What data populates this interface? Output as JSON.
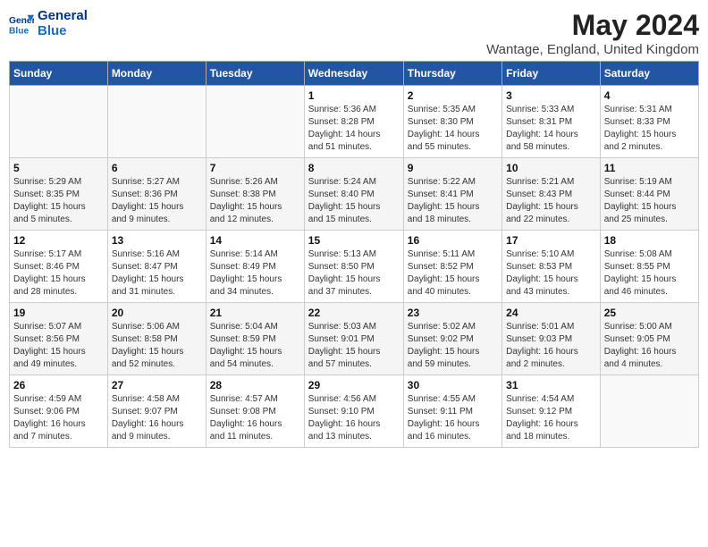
{
  "header": {
    "logo_line1": "General",
    "logo_line2": "Blue",
    "title": "May 2024",
    "subtitle": "Wantage, England, United Kingdom"
  },
  "columns": [
    "Sunday",
    "Monday",
    "Tuesday",
    "Wednesday",
    "Thursday",
    "Friday",
    "Saturday"
  ],
  "weeks": [
    {
      "days": [
        {
          "num": "",
          "info": ""
        },
        {
          "num": "",
          "info": ""
        },
        {
          "num": "",
          "info": ""
        },
        {
          "num": "1",
          "info": "Sunrise: 5:36 AM\nSunset: 8:28 PM\nDaylight: 14 hours\nand 51 minutes."
        },
        {
          "num": "2",
          "info": "Sunrise: 5:35 AM\nSunset: 8:30 PM\nDaylight: 14 hours\nand 55 minutes."
        },
        {
          "num": "3",
          "info": "Sunrise: 5:33 AM\nSunset: 8:31 PM\nDaylight: 14 hours\nand 58 minutes."
        },
        {
          "num": "4",
          "info": "Sunrise: 5:31 AM\nSunset: 8:33 PM\nDaylight: 15 hours\nand 2 minutes."
        }
      ]
    },
    {
      "days": [
        {
          "num": "5",
          "info": "Sunrise: 5:29 AM\nSunset: 8:35 PM\nDaylight: 15 hours\nand 5 minutes."
        },
        {
          "num": "6",
          "info": "Sunrise: 5:27 AM\nSunset: 8:36 PM\nDaylight: 15 hours\nand 9 minutes."
        },
        {
          "num": "7",
          "info": "Sunrise: 5:26 AM\nSunset: 8:38 PM\nDaylight: 15 hours\nand 12 minutes."
        },
        {
          "num": "8",
          "info": "Sunrise: 5:24 AM\nSunset: 8:40 PM\nDaylight: 15 hours\nand 15 minutes."
        },
        {
          "num": "9",
          "info": "Sunrise: 5:22 AM\nSunset: 8:41 PM\nDaylight: 15 hours\nand 18 minutes."
        },
        {
          "num": "10",
          "info": "Sunrise: 5:21 AM\nSunset: 8:43 PM\nDaylight: 15 hours\nand 22 minutes."
        },
        {
          "num": "11",
          "info": "Sunrise: 5:19 AM\nSunset: 8:44 PM\nDaylight: 15 hours\nand 25 minutes."
        }
      ]
    },
    {
      "days": [
        {
          "num": "12",
          "info": "Sunrise: 5:17 AM\nSunset: 8:46 PM\nDaylight: 15 hours\nand 28 minutes."
        },
        {
          "num": "13",
          "info": "Sunrise: 5:16 AM\nSunset: 8:47 PM\nDaylight: 15 hours\nand 31 minutes."
        },
        {
          "num": "14",
          "info": "Sunrise: 5:14 AM\nSunset: 8:49 PM\nDaylight: 15 hours\nand 34 minutes."
        },
        {
          "num": "15",
          "info": "Sunrise: 5:13 AM\nSunset: 8:50 PM\nDaylight: 15 hours\nand 37 minutes."
        },
        {
          "num": "16",
          "info": "Sunrise: 5:11 AM\nSunset: 8:52 PM\nDaylight: 15 hours\nand 40 minutes."
        },
        {
          "num": "17",
          "info": "Sunrise: 5:10 AM\nSunset: 8:53 PM\nDaylight: 15 hours\nand 43 minutes."
        },
        {
          "num": "18",
          "info": "Sunrise: 5:08 AM\nSunset: 8:55 PM\nDaylight: 15 hours\nand 46 minutes."
        }
      ]
    },
    {
      "days": [
        {
          "num": "19",
          "info": "Sunrise: 5:07 AM\nSunset: 8:56 PM\nDaylight: 15 hours\nand 49 minutes."
        },
        {
          "num": "20",
          "info": "Sunrise: 5:06 AM\nSunset: 8:58 PM\nDaylight: 15 hours\nand 52 minutes."
        },
        {
          "num": "21",
          "info": "Sunrise: 5:04 AM\nSunset: 8:59 PM\nDaylight: 15 hours\nand 54 minutes."
        },
        {
          "num": "22",
          "info": "Sunrise: 5:03 AM\nSunset: 9:01 PM\nDaylight: 15 hours\nand 57 minutes."
        },
        {
          "num": "23",
          "info": "Sunrise: 5:02 AM\nSunset: 9:02 PM\nDaylight: 15 hours\nand 59 minutes."
        },
        {
          "num": "24",
          "info": "Sunrise: 5:01 AM\nSunset: 9:03 PM\nDaylight: 16 hours\nand 2 minutes."
        },
        {
          "num": "25",
          "info": "Sunrise: 5:00 AM\nSunset: 9:05 PM\nDaylight: 16 hours\nand 4 minutes."
        }
      ]
    },
    {
      "days": [
        {
          "num": "26",
          "info": "Sunrise: 4:59 AM\nSunset: 9:06 PM\nDaylight: 16 hours\nand 7 minutes."
        },
        {
          "num": "27",
          "info": "Sunrise: 4:58 AM\nSunset: 9:07 PM\nDaylight: 16 hours\nand 9 minutes."
        },
        {
          "num": "28",
          "info": "Sunrise: 4:57 AM\nSunset: 9:08 PM\nDaylight: 16 hours\nand 11 minutes."
        },
        {
          "num": "29",
          "info": "Sunrise: 4:56 AM\nSunset: 9:10 PM\nDaylight: 16 hours\nand 13 minutes."
        },
        {
          "num": "30",
          "info": "Sunrise: 4:55 AM\nSunset: 9:11 PM\nDaylight: 16 hours\nand 16 minutes."
        },
        {
          "num": "31",
          "info": "Sunrise: 4:54 AM\nSunset: 9:12 PM\nDaylight: 16 hours\nand 18 minutes."
        },
        {
          "num": "",
          "info": ""
        }
      ]
    }
  ]
}
